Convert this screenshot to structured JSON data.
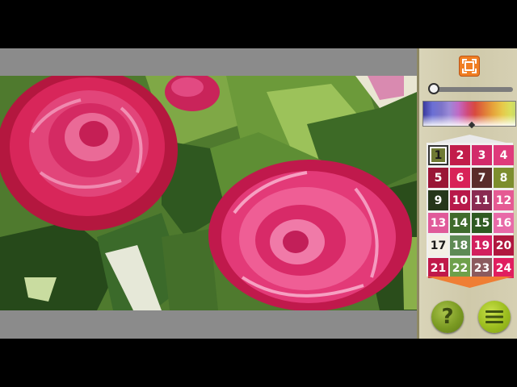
{
  "canvas": {
    "painting_name": "pink-camellias"
  },
  "toolbar": {
    "fit_icon": "fit-screen-icon",
    "zoom_level": 0
  },
  "palette": {
    "selected": "1",
    "swatches": [
      {
        "label": "1",
        "color": "#6f7a33",
        "text": "light"
      },
      {
        "label": "2",
        "color": "#c21d4a",
        "text": "dark"
      },
      {
        "label": "3",
        "color": "#d22a6a",
        "text": "dark"
      },
      {
        "label": "4",
        "color": "#df3a7b",
        "text": "dark"
      },
      {
        "label": "5",
        "color": "#9a1536",
        "text": "dark"
      },
      {
        "label": "6",
        "color": "#d82258",
        "text": "dark"
      },
      {
        "label": "7",
        "color": "#5a2c2a",
        "text": "dark"
      },
      {
        "label": "8",
        "color": "#7d8e2e",
        "text": "dark"
      },
      {
        "label": "9",
        "color": "#25361a",
        "text": "dark"
      },
      {
        "label": "10",
        "color": "#b8194a",
        "text": "dark"
      },
      {
        "label": "11",
        "color": "#8a2a52",
        "text": "dark"
      },
      {
        "label": "12",
        "color": "#e55a93",
        "text": "dark"
      },
      {
        "label": "13",
        "color": "#e05a9a",
        "text": "dark"
      },
      {
        "label": "14",
        "color": "#3f6b2c",
        "text": "dark"
      },
      {
        "label": "15",
        "color": "#2e5a22",
        "text": "dark"
      },
      {
        "label": "16",
        "color": "#e86aa8",
        "text": "dark"
      },
      {
        "label": "17",
        "color": "#f3f0e6",
        "text": "light"
      },
      {
        "label": "18",
        "color": "#5e8a55",
        "text": "dark"
      },
      {
        "label": "19",
        "color": "#d21f5e",
        "text": "dark"
      },
      {
        "label": "20",
        "color": "#b0183f",
        "text": "dark"
      },
      {
        "label": "21",
        "color": "#c0194a",
        "text": "dark"
      },
      {
        "label": "22",
        "color": "#6ea04a",
        "text": "dark"
      },
      {
        "label": "23",
        "color": "#8b5a5e",
        "text": "dark"
      },
      {
        "label": "24",
        "color": "#e01e5f",
        "text": "dark"
      }
    ]
  },
  "buttons": {
    "help_label": "?"
  },
  "colors": {
    "panel": "#d6d0b3",
    "accent_orange": "#f07e22",
    "accent_green": "#9bbd1e"
  }
}
